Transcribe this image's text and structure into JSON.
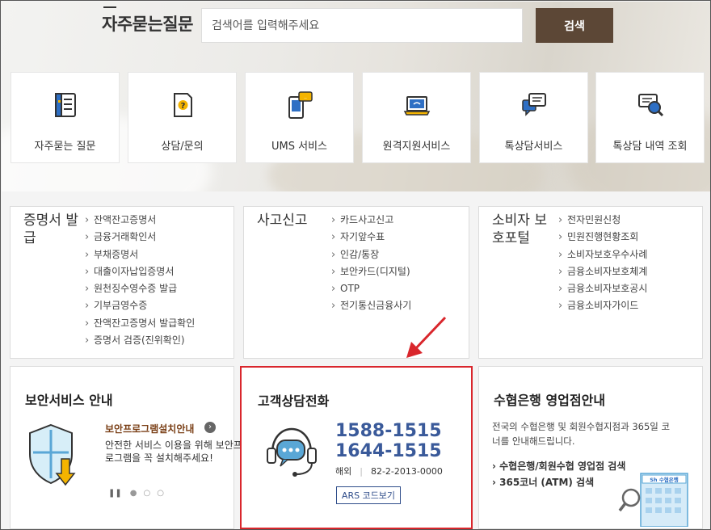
{
  "hero": {
    "title": "자주묻는질문",
    "search_placeholder": "검색어를 입력해주세요",
    "search_button": "검색",
    "tiles": [
      {
        "label": "자주묻는 질문",
        "icon": "faq-book-icon"
      },
      {
        "label": "상담/문의",
        "icon": "question-doc-icon"
      },
      {
        "label": "UMS 서비스",
        "icon": "mobile-chat-icon"
      },
      {
        "label": "원격지원서비스",
        "icon": "laptop-wifi-icon"
      },
      {
        "label": "톡상담서비스",
        "icon": "chat-bubble-icon"
      },
      {
        "label": "톡상담 내역 조회",
        "icon": "search-chat-icon"
      }
    ]
  },
  "panels": {
    "certificates": {
      "title": "증명서 발급",
      "items": [
        "잔액잔고증명서",
        "금융거래확인서",
        "부채증명서",
        "대출이자납입증명서",
        "원천징수영수증 발급",
        "기부금영수증",
        "잔액잔고증명서 발급확인",
        "증명서 검증(진위확인)"
      ]
    },
    "accident": {
      "title": "사고신고",
      "items": [
        "카드사고신고",
        "자기앞수표",
        "인감/통장",
        "보안카드(디지털)",
        "OTP",
        "전기통신금융사기"
      ]
    },
    "consumer": {
      "title": "소비자 보호포털",
      "items": [
        "전자민원신청",
        "민원진행현황조회",
        "소비자보호우수사례",
        "금융소비자보호체계",
        "금융소비자보호공시",
        "금융소비자가이드"
      ]
    }
  },
  "security": {
    "title": "보안서비스 안내",
    "link": "보안프로그램설치안내",
    "desc": "안전한 서비스 이용을 위해 보안프로그램을 꼭 설치해주세요!"
  },
  "callcenter": {
    "title": "고객상담전화",
    "phone1": "1588-1515",
    "phone2": "1644-1515",
    "overseas_label": "해외",
    "overseas_number": "82-2-2013-0000",
    "ars_button": "ARS 코드보기"
  },
  "branch": {
    "title": "수협은행 영업점안내",
    "desc": "전국의 수협은행 및 회원수협지점과 365일 코너를 안내해드립니다.",
    "links": [
      "수협은행/회원수협 영업점 검색",
      "365코너 (ATM) 검색"
    ],
    "sign_text": "Sh 수협은행"
  },
  "colors": {
    "accent_brown": "#5c4736",
    "phone_blue": "#3a5a9a",
    "highlight_red": "#d9262c"
  }
}
